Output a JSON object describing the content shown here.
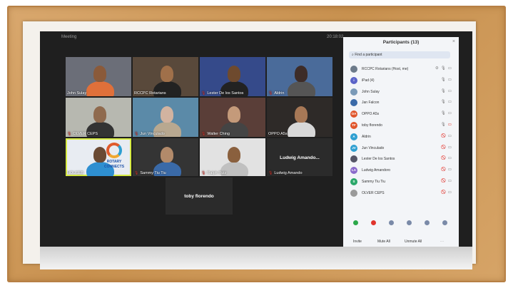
{
  "window": {
    "title": "Meeting",
    "time": "20:18:02"
  },
  "tiles": [
    {
      "name": "John Sulay",
      "mic_off": false,
      "bg": "#6b6e78",
      "skin": "#8a5a3a",
      "shirt": "#e0703a"
    },
    {
      "name": "RCCPC Rotarians",
      "mic_off": false,
      "bg": "#59493b",
      "skin": "#a0704a",
      "shirt": "#222"
    },
    {
      "name": "Lester De los Santos",
      "mic_off": true,
      "bg": "#354a8a",
      "skin": "#6e4a2e",
      "shirt": "#222"
    },
    {
      "name": "Aldrin",
      "mic_off": true,
      "bg": "#4a6b9a",
      "skin": "#3d2c28",
      "shirt": "#555"
    },
    {
      "name": "OLVER CEPS",
      "mic_off": true,
      "bg": "#b7b8b0",
      "skin": "#8f6a4e",
      "shirt": "#333"
    },
    {
      "name": "Jun Vinculado",
      "mic_off": true,
      "bg": "#5b8aa8",
      "skin": "#d2b3a0",
      "shirt": "#b8a890"
    },
    {
      "name": "Walter Ching",
      "mic_off": true,
      "bg": "#5a3e38",
      "skin": "#c49a7a",
      "shirt": "#444"
    },
    {
      "name": "OPPO A5s",
      "mic_off": false,
      "bg": "#2e2a28",
      "skin": "#a77856",
      "shirt": "#d8d8d8"
    },
    {
      "name": "HOUSEB",
      "mic_off": false,
      "bg": "#e8ecf2",
      "skin": "#6a4a34",
      "shirt": "#2e8fd1",
      "logo": [
        "ROTARY",
        "CONNECTS"
      ],
      "active": true
    },
    {
      "name": "Sammy Tiu Tiu",
      "mic_off": true,
      "bg": "#343434",
      "skin": "#b28a6a",
      "shirt": "#3a6aa8"
    },
    {
      "name": "Ralph Ruiz",
      "mic_off": true,
      "bg": "#e2e2e2",
      "skin": "#8a603e",
      "shirt": "#c0c0c0"
    },
    {
      "name": "Ludwig Amando",
      "mic_off": true,
      "text_only": true,
      "center_text": "Ludwig Amando..."
    }
  ],
  "bottom_tile": {
    "center_text": "toby florendo"
  },
  "panel": {
    "title": "Participants (13)",
    "search_placeholder": "Find a participant",
    "participants": [
      {
        "name": "RCCPC Rotarians (Host, me)",
        "initials": "",
        "color": "#6c7a8a",
        "mic_off": false,
        "video_off": false,
        "hand": true
      },
      {
        "name": "iPad (4)",
        "initials": "i",
        "color": "#5a63c8",
        "mic_off": false,
        "video_off": false
      },
      {
        "name": "John Sulay",
        "initials": "",
        "color": "#7a9ab8",
        "mic_off": false,
        "video_off": false
      },
      {
        "name": "Jan Falcon",
        "initials": "",
        "color": "#3a6aa8",
        "mic_off": false,
        "video_off": false
      },
      {
        "name": "OPPO A5s",
        "initials": "OA",
        "color": "#e0562c",
        "mic_off": false,
        "video_off": false
      },
      {
        "name": "toby florendo",
        "initials": "TF",
        "color": "#e0562c",
        "mic_off": false,
        "video_off": true
      },
      {
        "name": "Aldrin",
        "initials": "A",
        "color": "#2e9fd1",
        "mic_off": true,
        "video_off": false
      },
      {
        "name": "Jun Vinculado",
        "initials": "JV",
        "color": "#2e9fd1",
        "mic_off": true,
        "video_off": false
      },
      {
        "name": "Lester De los Santos",
        "initials": "",
        "color": "#556",
        "mic_off": true,
        "video_off": false
      },
      {
        "name": "Ludwig Amandoro",
        "initials": "LA",
        "color": "#8a6acb",
        "mic_off": true,
        "video_off": false
      },
      {
        "name": "Sammy Tiu Tiu",
        "initials": "S",
        "color": "#2ba86a",
        "mic_off": true,
        "video_off": false
      },
      {
        "name": "OLVER CEPS",
        "initials": "",
        "color": "#9a9a9a",
        "mic_off": true,
        "video_off": false
      }
    ],
    "reactions": [
      "#2ba84a",
      "#e0342c",
      "#7a8aa8",
      "#7a8aa8",
      "#7a8aa8",
      "#7a8aa8"
    ],
    "buttons": {
      "invite": "Invite",
      "mute_all": "Mute All",
      "unmute_all": "Unmute All"
    }
  }
}
